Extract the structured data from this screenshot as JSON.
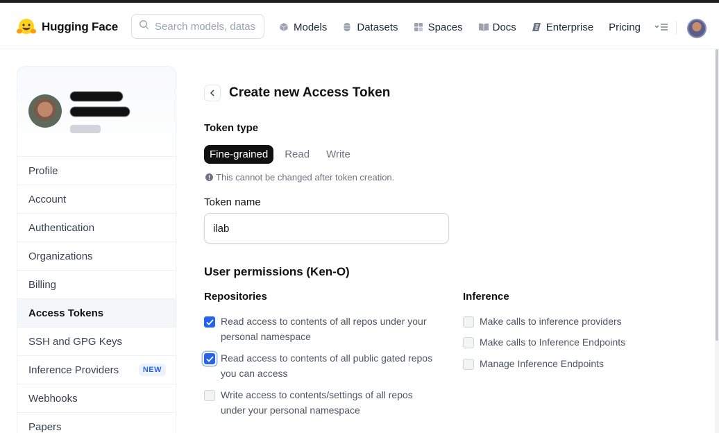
{
  "header": {
    "brand": "Hugging Face",
    "search_placeholder": "Search models, datasets",
    "nav": [
      {
        "label": "Models",
        "icon": "cube-icon"
      },
      {
        "label": "Datasets",
        "icon": "database-icon"
      },
      {
        "label": "Spaces",
        "icon": "grid-icon"
      },
      {
        "label": "Docs",
        "icon": "book-icon"
      },
      {
        "label": "Enterprise",
        "icon": "enterprise-icon"
      },
      {
        "label": "Pricing",
        "icon": ""
      }
    ],
    "more_icon": "chevron-menu-icon"
  },
  "sidebar": {
    "items": [
      {
        "label": "Profile"
      },
      {
        "label": "Account"
      },
      {
        "label": "Authentication"
      },
      {
        "label": "Organizations"
      },
      {
        "label": "Billing"
      },
      {
        "label": "Access Tokens",
        "active": true
      },
      {
        "label": "SSH and GPG Keys"
      },
      {
        "label": "Inference Providers",
        "badge": "NEW"
      },
      {
        "label": "Webhooks"
      },
      {
        "label": "Papers"
      }
    ]
  },
  "main": {
    "title": "Create new Access Token",
    "token_type_label": "Token type",
    "token_types": [
      "Fine-grained",
      "Read",
      "Write"
    ],
    "selected_token_type": "Fine-grained",
    "hint": "This cannot be changed after token creation.",
    "token_name_label": "Token name",
    "token_name_value": "ilab",
    "permissions_title": "User permissions (Ken-O)",
    "repositories_label": "Repositories",
    "inference_label": "Inference",
    "repositories": [
      {
        "line1": "Read access to contents of all repos under your",
        "line2": "personal namespace",
        "checked": true
      },
      {
        "line1": "Read access to contents of all public gated repos",
        "line2": "you can access",
        "checked": true
      },
      {
        "line1": "Write access to contents/settings of all repos",
        "line2": "under your personal namespace",
        "checked": false
      }
    ],
    "inference": [
      {
        "label": "Make calls to inference providers",
        "checked": false
      },
      {
        "label": "Make calls to Inference Endpoints",
        "checked": false
      },
      {
        "label": "Manage Inference Endpoints",
        "checked": false
      }
    ]
  },
  "colors": {
    "accent": "#2563eb",
    "selected_tab": "#111111"
  }
}
